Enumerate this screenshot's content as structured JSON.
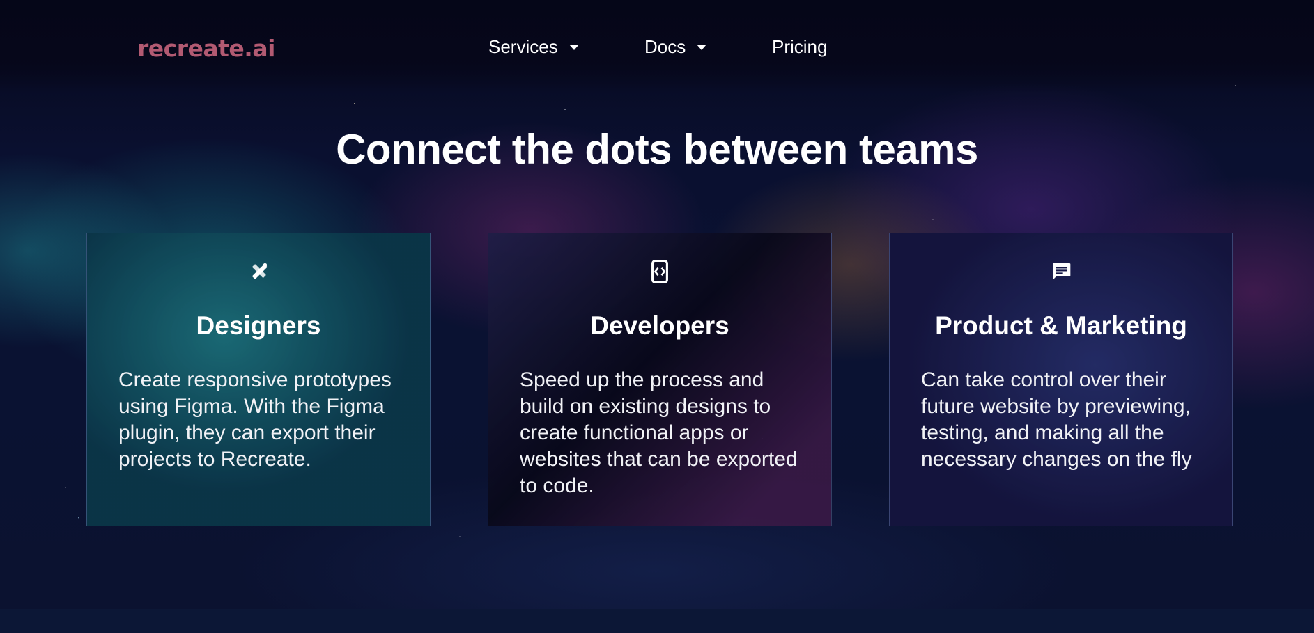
{
  "brand": {
    "logo_text": "recreate.ai",
    "logo_color": "#b25a72"
  },
  "nav": {
    "items": [
      {
        "label": "Services",
        "has_dropdown": true
      },
      {
        "label": "Docs",
        "has_dropdown": true
      },
      {
        "label": "Pricing",
        "has_dropdown": false
      }
    ]
  },
  "hero": {
    "headline": "Connect the dots between teams"
  },
  "cards": [
    {
      "icon": "design-tools-icon",
      "title": "Designers",
      "description": "Create responsive prototypes using Figma. With the Figma plugin, they can export their projects to Recreate."
    },
    {
      "icon": "code-device-icon",
      "title": "Developers",
      "description": "Speed up the process and build on existing designs to create functional apps or websites that can be exported to code."
    },
    {
      "icon": "chat-message-icon",
      "title": "Product & Marketing",
      "description": "Can take control over their future website by previewing, testing, and making all the necessary changes on the fly"
    }
  ],
  "colors": {
    "background": "#070820",
    "text": "#ffffff",
    "card_border": "#5a6ea0"
  }
}
